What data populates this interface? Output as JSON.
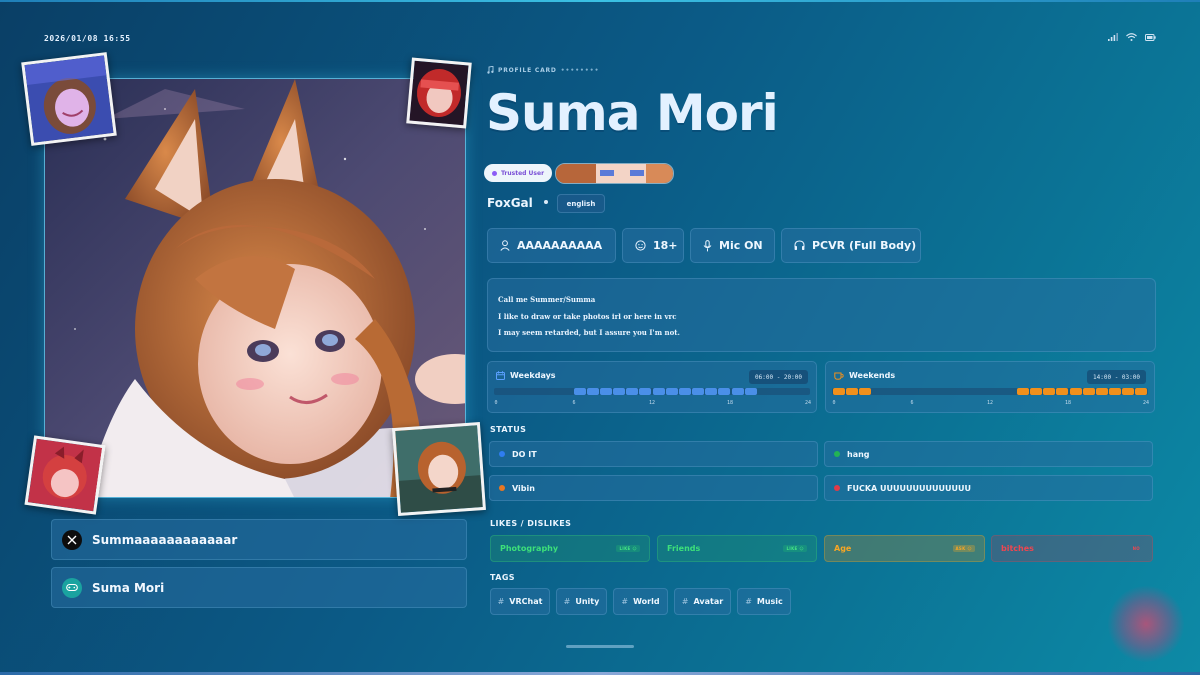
{
  "status_bar": {
    "datetime": "2026/01/08 16:55",
    "icons": [
      "signal-icon",
      "wifi-icon",
      "battery-icon"
    ]
  },
  "profile": {
    "kicker": "PROFILE CARD",
    "kicker_dots": "••••••••",
    "name": "Suma Mori",
    "trusted_badge": "Trusted User",
    "pronoun": "FoxGal",
    "language": "english"
  },
  "chips": [
    {
      "label": "AAAAAAAAAA",
      "icon": "person-icon"
    },
    {
      "label": "18+",
      "icon": "age-icon"
    },
    {
      "label": "Mic ON",
      "icon": "microphone-icon"
    },
    {
      "label": "PCVR (Full Body)",
      "icon": "headset-icon"
    }
  ],
  "bio": {
    "lines": [
      "Call me Summer/Summa",
      "",
      "I like to draw or take photos irl or here in vrc",
      "I may seem retarded, but I assure you I'm not."
    ]
  },
  "schedule": {
    "weekdays": {
      "label": "Weekdays",
      "time": "06:00 - 20:00",
      "start": 6,
      "end": 20,
      "color": "#4a8fe8",
      "icon": "calendar-icon"
    },
    "weekends": {
      "label": "Weekends",
      "time": "14:00 - 03:00",
      "start": 14,
      "end": 3,
      "color": "#f0901c",
      "icon": "coffee-icon"
    },
    "ticks": [
      "0",
      "6",
      "12",
      "18",
      "24"
    ]
  },
  "status": {
    "heading": "STATUS",
    "items": [
      {
        "label": "DO IT",
        "color": "#2f7df0"
      },
      {
        "label": "hang",
        "color": "#22b455"
      },
      {
        "label": "Vibin",
        "color": "#e87722"
      },
      {
        "label": "FUCKA UUUUUUUUUUUUUU",
        "color": "#e23a48"
      }
    ]
  },
  "likes": {
    "heading": "LIKES / DISLIKES",
    "items": [
      {
        "label": "Photography",
        "badge": "LIKE",
        "color": "#2fcf5e"
      },
      {
        "label": "Friends",
        "badge": "LIKE",
        "color": "#2fcf5e"
      },
      {
        "label": "Age",
        "badge": "ASK",
        "color": "#f0a020"
      },
      {
        "label": "bitches",
        "badge": "NO",
        "color": "#e8404a"
      }
    ]
  },
  "tags": {
    "heading": "TAGS",
    "hash": "#",
    "items": [
      "VRChat",
      "Unity",
      "World",
      "Avatar",
      "Music"
    ]
  },
  "links": [
    {
      "label": "Summaaaaaaaaaaaar",
      "icon": "x-logo-icon"
    },
    {
      "label": "Suma Mori",
      "icon": "gamepad-icon"
    }
  ]
}
